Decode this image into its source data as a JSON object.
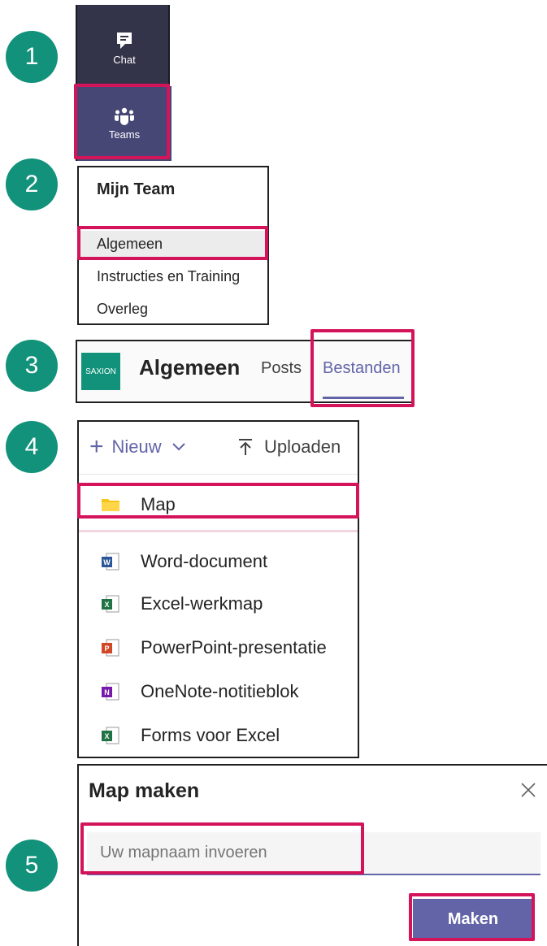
{
  "steps": [
    "1",
    "2",
    "3",
    "4",
    "5"
  ],
  "rail": {
    "chat_label": "Chat",
    "teams_label": "Teams"
  },
  "team": {
    "title": "Mijn Team",
    "channels": [
      "Algemeen",
      "Instructies en Training",
      "Overleg"
    ]
  },
  "tabbar": {
    "logo_text": "SAXION",
    "channel": "Algemeen",
    "tabs": [
      "Posts",
      "Bestanden"
    ]
  },
  "new_menu": {
    "new_label": "Nieuw",
    "upload_label": "Uploaden",
    "items": [
      {
        "label": "Map",
        "icon": "folder-icon"
      },
      {
        "label": "Word-document",
        "icon": "word-icon"
      },
      {
        "label": "Excel-werkmap",
        "icon": "excel-icon"
      },
      {
        "label": "PowerPoint-presentatie",
        "icon": "powerpoint-icon"
      },
      {
        "label": "OneNote-notitieblok",
        "icon": "onenote-icon"
      },
      {
        "label": "Forms voor Excel",
        "icon": "forms-excel-icon"
      }
    ]
  },
  "dialog": {
    "title": "Map maken",
    "placeholder": "Uw mapnaam invoeren",
    "submit_label": "Maken"
  },
  "colors": {
    "accent": "#6264a7",
    "highlight": "#d4145a",
    "step": "#12927a",
    "rail": "#33344a"
  }
}
